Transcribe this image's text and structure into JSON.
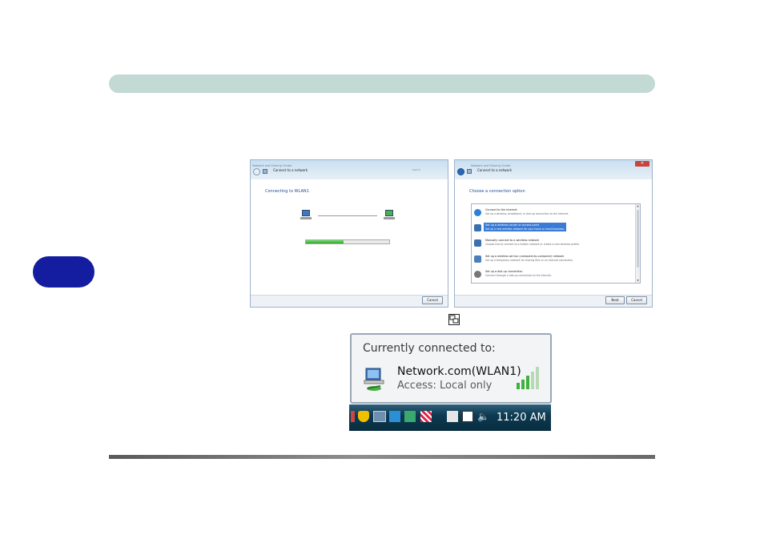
{
  "chapter_tab": {
    "label": ""
  },
  "dialog_connecting": {
    "title": "Connect to a network",
    "heading": "Connecting to WLAN1",
    "glass_text": "Network and Sharing Center",
    "glass_link": "Search",
    "progress": 0.45,
    "cancel_label": "Cancel"
  },
  "dialog_options": {
    "title": "Connect to a network",
    "glass_text": "Network and Sharing Center",
    "heading": "Choose a connection option",
    "options": [
      {
        "title": "Connect to the Internet",
        "desc": "Set up a wireless, broadband, or dial-up connection to the Internet.",
        "icon": "globe-icon",
        "color": "#2f7ed8"
      },
      {
        "title": "Set up a wireless router or access point",
        "desc": "Set up a new wireless network for your home or small business.",
        "icon": "router-icon",
        "color": "#3a6fb0"
      },
      {
        "title": "Manually connect to a wireless network",
        "desc": "Choose this to connect to a hidden network or create a new wireless profile.",
        "icon": "wireless-computer-icon",
        "color": "#3a6fb0"
      },
      {
        "title": "Set up a wireless ad hoc (computer-to-computer) network",
        "desc": "Set up a temporary network for sharing files or an Internet connection.",
        "icon": "adhoc-icon",
        "color": "#4a7fba"
      },
      {
        "title": "Set up a dial-up connection",
        "desc": "Connect through a dial-up connection to the Internet.",
        "icon": "phone-icon",
        "color": "#777777"
      }
    ],
    "selected_index": 1,
    "next_label": "Next",
    "cancel_label": "Cancel"
  },
  "balloon": {
    "heading": "Currently connected to:",
    "network": "Network.com(WLAN1)",
    "access": "Access:  Local only"
  },
  "taskbar": {
    "clock": "11:20 AM"
  }
}
